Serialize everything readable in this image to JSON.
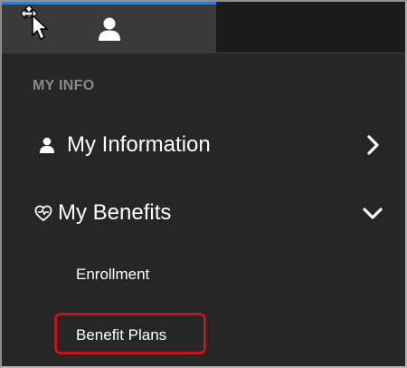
{
  "section": {
    "label": "MY INFO"
  },
  "menu": {
    "items": [
      {
        "label": "My Information",
        "icon": "person-icon",
        "chevron": "chevron-right-icon",
        "expanded": false
      },
      {
        "label": "My Benefits",
        "icon": "heart-health-icon",
        "chevron": "chevron-down-icon",
        "expanded": true,
        "children": [
          {
            "label": "Enrollment"
          },
          {
            "label": "Benefit Plans",
            "highlighted": true
          }
        ]
      }
    ]
  },
  "colors": {
    "panel_background": "#262626",
    "tab_active_background": "#3a3a3a",
    "tab_accent": "#2f7fd0",
    "section_label": "#8a8a8a",
    "text": "#ffffff",
    "highlight": "#c0161d"
  }
}
